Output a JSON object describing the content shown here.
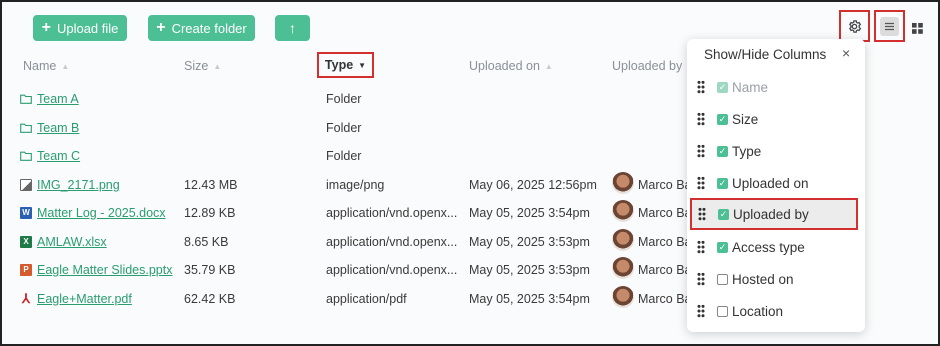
{
  "toolbar": {
    "upload_label": "Upload file",
    "create_folder_label": "Create folder",
    "up_label": "↑"
  },
  "columns": {
    "name": "Name",
    "size": "Size",
    "type": "Type",
    "uploaded_on": "Uploaded on",
    "uploaded_by": "Uploaded by"
  },
  "rows": [
    {
      "icon": "folder-icon",
      "name": "Team A",
      "size": "",
      "type": "Folder",
      "date": "",
      "by": ""
    },
    {
      "icon": "folder-icon",
      "name": "Team B",
      "size": "",
      "type": "Folder",
      "date": "",
      "by": ""
    },
    {
      "icon": "folder-icon",
      "name": "Team C",
      "size": "",
      "type": "Folder",
      "date": "",
      "by": ""
    },
    {
      "icon": "image-file-icon",
      "name": "IMG_2171.png",
      "size": "12.43 MB",
      "type": "image/png",
      "date": "May 06, 2025 12:56pm",
      "by": "Marco Ba"
    },
    {
      "icon": "word-file-icon",
      "name": "Matter Log - 2025.docx",
      "size": "12.89 KB",
      "type": "application/vnd.openx...",
      "date": "May 05, 2025 3:54pm",
      "by": "Marco Ba"
    },
    {
      "icon": "excel-file-icon",
      "name": "AMLAW.xlsx",
      "size": "8.65 KB",
      "type": "application/vnd.openx...",
      "date": "May 05, 2025 3:53pm",
      "by": "Marco Ba"
    },
    {
      "icon": "powerpoint-file-icon",
      "name": "Eagle Matter Slides.pptx",
      "size": "35.79 KB",
      "type": "application/vnd.openx...",
      "date": "May 05, 2025 3:53pm",
      "by": "Marco Ba"
    },
    {
      "icon": "pdf-file-icon",
      "name": "Eagle+Matter.pdf",
      "size": "62.42 KB",
      "type": "application/pdf",
      "date": "May 05, 2025 3:54pm",
      "by": "Marco Ba"
    }
  ],
  "panel": {
    "title": "Show/Hide Columns",
    "close": "×",
    "options": [
      {
        "label": "Name",
        "checked": true,
        "disabled": true
      },
      {
        "label": "Size",
        "checked": true
      },
      {
        "label": "Type",
        "checked": true
      },
      {
        "label": "Uploaded on",
        "checked": true
      },
      {
        "label": "Uploaded by",
        "checked": true,
        "highlighted": true
      },
      {
        "label": "Access type",
        "checked": true
      },
      {
        "label": "Hosted on",
        "checked": false
      },
      {
        "label": "Location",
        "checked": false
      }
    ]
  },
  "colors": {
    "accent": "#4cbf94",
    "link": "#2a9d6f",
    "highlight_border": "#d32f2f"
  }
}
